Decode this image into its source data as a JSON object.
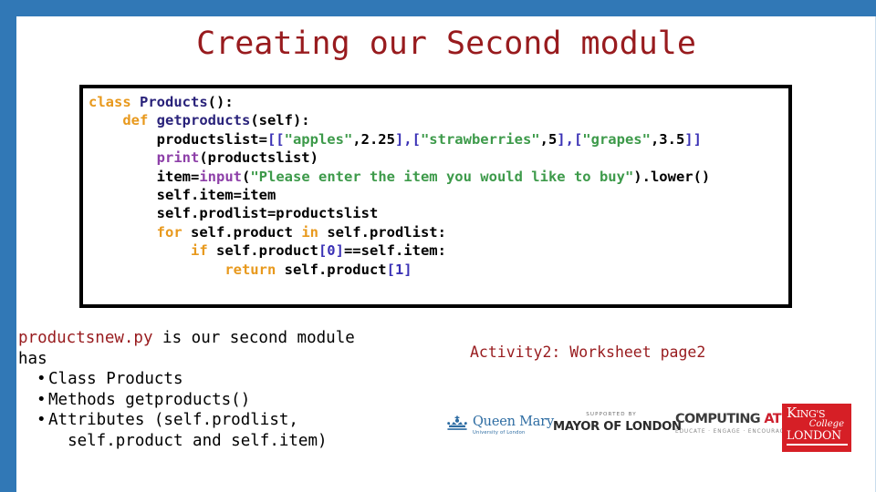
{
  "slide": {
    "title": "Creating our Second module",
    "title_color": "#981b1e",
    "edge_color": "#3178b6"
  },
  "code_block": {
    "language": "python",
    "lines": [
      [
        {
          "t": "class ",
          "c": "kw"
        },
        {
          "t": "Products",
          "c": "fn"
        },
        {
          "t": "():",
          "c": "pl"
        }
      ],
      [
        {
          "t": "    ",
          "c": "pl"
        },
        {
          "t": "def ",
          "c": "kw"
        },
        {
          "t": "getproducts",
          "c": "fn"
        },
        {
          "t": "(self):",
          "c": "pl"
        }
      ],
      [
        {
          "t": "        productslist=",
          "c": "pl"
        },
        {
          "t": "[[",
          "c": "br"
        },
        {
          "t": "\"apples\"",
          "c": "str"
        },
        {
          "t": ",2.25",
          "c": "pl"
        },
        {
          "t": "],[",
          "c": "br"
        },
        {
          "t": "\"strawberries\"",
          "c": "str"
        },
        {
          "t": ",5",
          "c": "pl"
        },
        {
          "t": "],[",
          "c": "br"
        },
        {
          "t": "\"grapes\"",
          "c": "str"
        },
        {
          "t": ",3.5",
          "c": "pl"
        },
        {
          "t": "]]",
          "c": "br"
        }
      ],
      [
        {
          "t": "        ",
          "c": "pl"
        },
        {
          "t": "print",
          "c": "bi"
        },
        {
          "t": "(productslist)",
          "c": "pl"
        }
      ],
      [
        {
          "t": "        item=",
          "c": "pl"
        },
        {
          "t": "input",
          "c": "bi"
        },
        {
          "t": "(",
          "c": "pl"
        },
        {
          "t": "\"Please enter the item you would like to buy\"",
          "c": "str"
        },
        {
          "t": ").lower()",
          "c": "pl"
        }
      ],
      [
        {
          "t": "        self.item=item",
          "c": "pl"
        }
      ],
      [
        {
          "t": "        self.prodlist=productslist",
          "c": "pl"
        }
      ],
      [
        {
          "t": "        ",
          "c": "pl"
        },
        {
          "t": "for ",
          "c": "kw"
        },
        {
          "t": "self.product ",
          "c": "pl"
        },
        {
          "t": "in ",
          "c": "kw"
        },
        {
          "t": "self.prodlist:",
          "c": "pl"
        }
      ],
      [
        {
          "t": "            ",
          "c": "pl"
        },
        {
          "t": "if ",
          "c": "kw"
        },
        {
          "t": "self.product",
          "c": "pl"
        },
        {
          "t": "[0]",
          "c": "br"
        },
        {
          "t": "==self.item:",
          "c": "pl"
        }
      ],
      [
        {
          "t": "                ",
          "c": "pl"
        },
        {
          "t": "return ",
          "c": "kw"
        },
        {
          "t": "self.product",
          "c": "pl"
        },
        {
          "t": "[1]",
          "c": "br"
        }
      ]
    ]
  },
  "body": {
    "lead_accent": "productsnew.py",
    "lead_rest": " is our second module",
    "lead_second": "has",
    "bullet_marker": "•",
    "bullets": [
      "Class Products",
      "Methods getproducts()",
      "Attributes (self.prodlist,\n  self.product and self.item)"
    ]
  },
  "activity": {
    "text": "Activity2: Worksheet page2"
  },
  "logos": {
    "queen_mary": {
      "icon": "crown-icon",
      "name": "Queen Mary",
      "subtitle": "University of London",
      "color": "#2d6ca2"
    },
    "mayor": {
      "supported_by": "SUPPORTED BY",
      "name": "MAYOR OF LONDON"
    },
    "computing_at_school": {
      "name_part1": "COMPUTING ",
      "name_part2": "AT SCHOOL",
      "tagline": "EDUCATE · ENGAGE · ENCOURAGE",
      "accent": "#cc1f2d"
    },
    "kings_college": {
      "k": "K",
      "ings": "ING'S",
      "college": "College",
      "london": "LONDON",
      "background": "#d61f26"
    }
  }
}
